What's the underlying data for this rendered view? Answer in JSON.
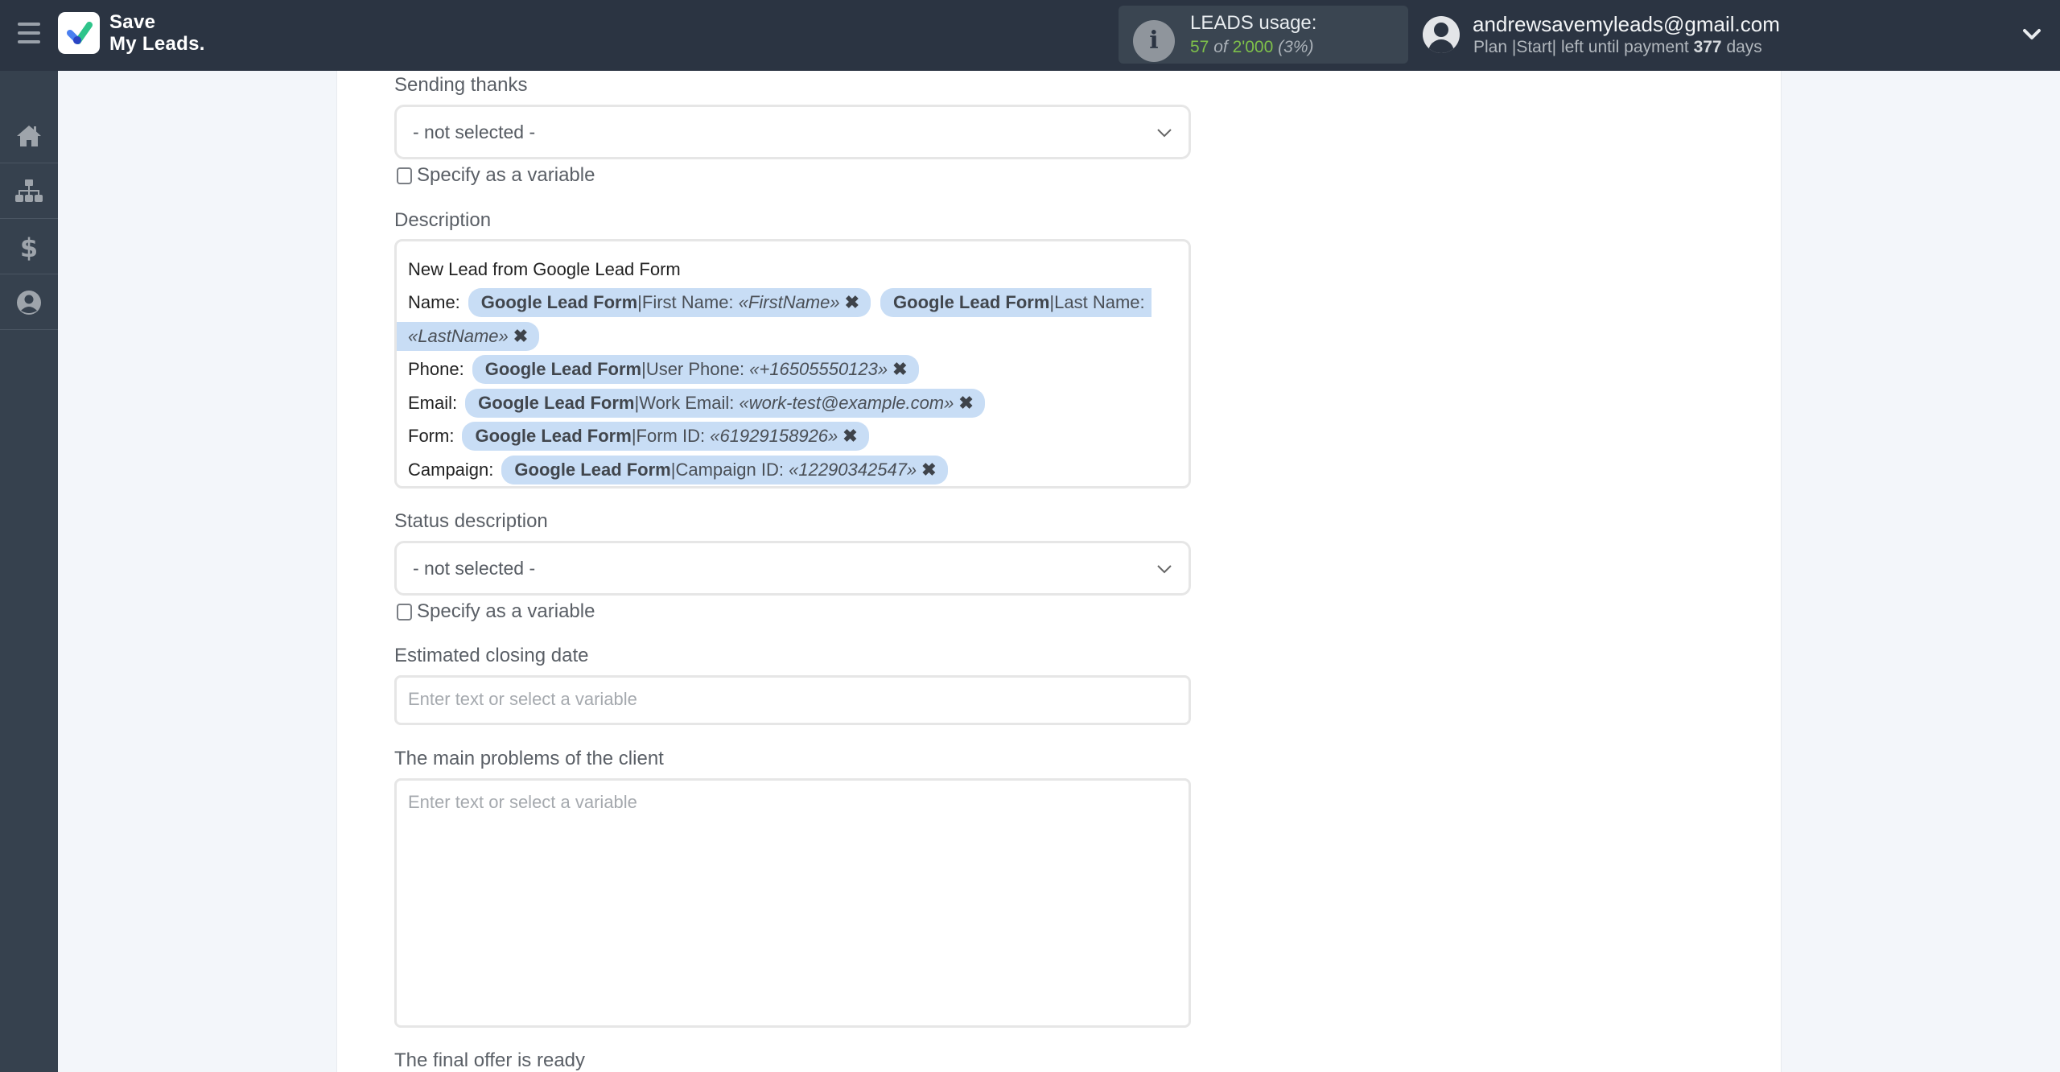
{
  "header": {
    "logo_line1": "Save",
    "logo_line2": "My Leads.",
    "usage": {
      "title": "LEADS usage:",
      "used": "57",
      "of_word": "of",
      "limit": "2'000",
      "percent_text": "(3%)"
    },
    "user": {
      "email": "andrewsavemyleads@gmail.com",
      "plan_prefix": "Plan |Start| left until payment",
      "days": "377",
      "days_suffix": "days"
    }
  },
  "sidebar": {
    "items": [
      {
        "name": "home",
        "icon": "home-icon"
      },
      {
        "name": "connections",
        "icon": "sitemap-icon"
      },
      {
        "name": "billing",
        "icon": "dollar-icon"
      },
      {
        "name": "account",
        "icon": "user-circle-icon"
      }
    ]
  },
  "form": {
    "sending_thanks": {
      "label": "Sending thanks",
      "value": "- not selected -",
      "checkbox_label": "Specify as a variable",
      "checked": false
    },
    "description": {
      "label": "Description",
      "first_line": "New Lead from Google Lead Form",
      "lines": [
        {
          "label": "Name:",
          "chips": [
            {
              "source": "Google Lead Form",
              "field": "First Name:",
              "value": "«FirstName»"
            },
            {
              "source": "Google Lead Form",
              "field": "Last Name:",
              "value": "«LastName»"
            }
          ]
        },
        {
          "label": "Phone:",
          "chips": [
            {
              "source": "Google Lead Form",
              "field": "User Phone:",
              "value": "«+16505550123»"
            }
          ]
        },
        {
          "label": "Email:",
          "chips": [
            {
              "source": "Google Lead Form",
              "field": "Work Email:",
              "value": "«work-test@example.com»"
            }
          ]
        },
        {
          "label": "Form:",
          "chips": [
            {
              "source": "Google Lead Form",
              "field": "Form ID:",
              "value": "«61929158926»"
            }
          ]
        },
        {
          "label": "Campaign:",
          "chips": [
            {
              "source": "Google Lead Form",
              "field": "Campaign ID:",
              "value": "«12290342547»"
            }
          ]
        }
      ],
      "sep": " | ",
      "remove_glyph": "✖"
    },
    "status_description": {
      "label": "Status description",
      "value": "- not selected -",
      "checkbox_label": "Specify as a variable",
      "checked": false
    },
    "estimated_closing_date": {
      "label": "Estimated closing date",
      "placeholder": "Enter text or select a variable",
      "value": ""
    },
    "main_problems": {
      "label": "The main problems of the client",
      "placeholder": "Enter text or select a variable",
      "value": ""
    },
    "final_offer": {
      "label": "The final offer is ready"
    }
  }
}
